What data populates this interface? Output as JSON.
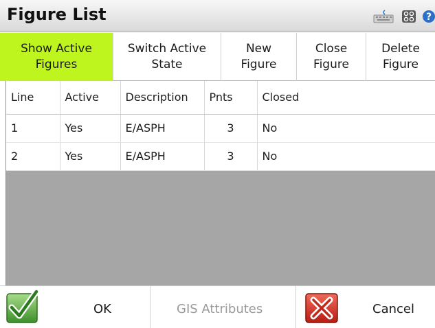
{
  "window": {
    "title": "Figure List",
    "icons": [
      "keyboard-icon",
      "grid-icon",
      "help-icon"
    ]
  },
  "toolbar": {
    "buttons": [
      {
        "line1": "Show Active",
        "line2": "Figures",
        "active": true
      },
      {
        "line1": "Switch Active",
        "line2": "State",
        "active": false
      },
      {
        "line1": "New",
        "line2": "Figure",
        "active": false
      },
      {
        "line1": "Close",
        "line2": "Figure",
        "active": false
      },
      {
        "line1": "Delete",
        "line2": "Figure",
        "active": false
      }
    ],
    "active_color": "#bff51f"
  },
  "table": {
    "columns": [
      "Line",
      "Active",
      "Description",
      "Pnts",
      "Closed"
    ],
    "sort_column": "Line",
    "rows": [
      {
        "line": "1",
        "active": "Yes",
        "description": "E/ASPH",
        "pnts": "3",
        "closed": "No"
      },
      {
        "line": "2",
        "active": "Yes",
        "description": "E/ASPH",
        "pnts": "3",
        "closed": "No"
      }
    ]
  },
  "footer": {
    "ok_label": "OK",
    "gis_label": "GIS Attributes",
    "cancel_label": "Cancel",
    "ok_icon": "checkmark-icon",
    "cancel_icon": "red-x-icon"
  }
}
